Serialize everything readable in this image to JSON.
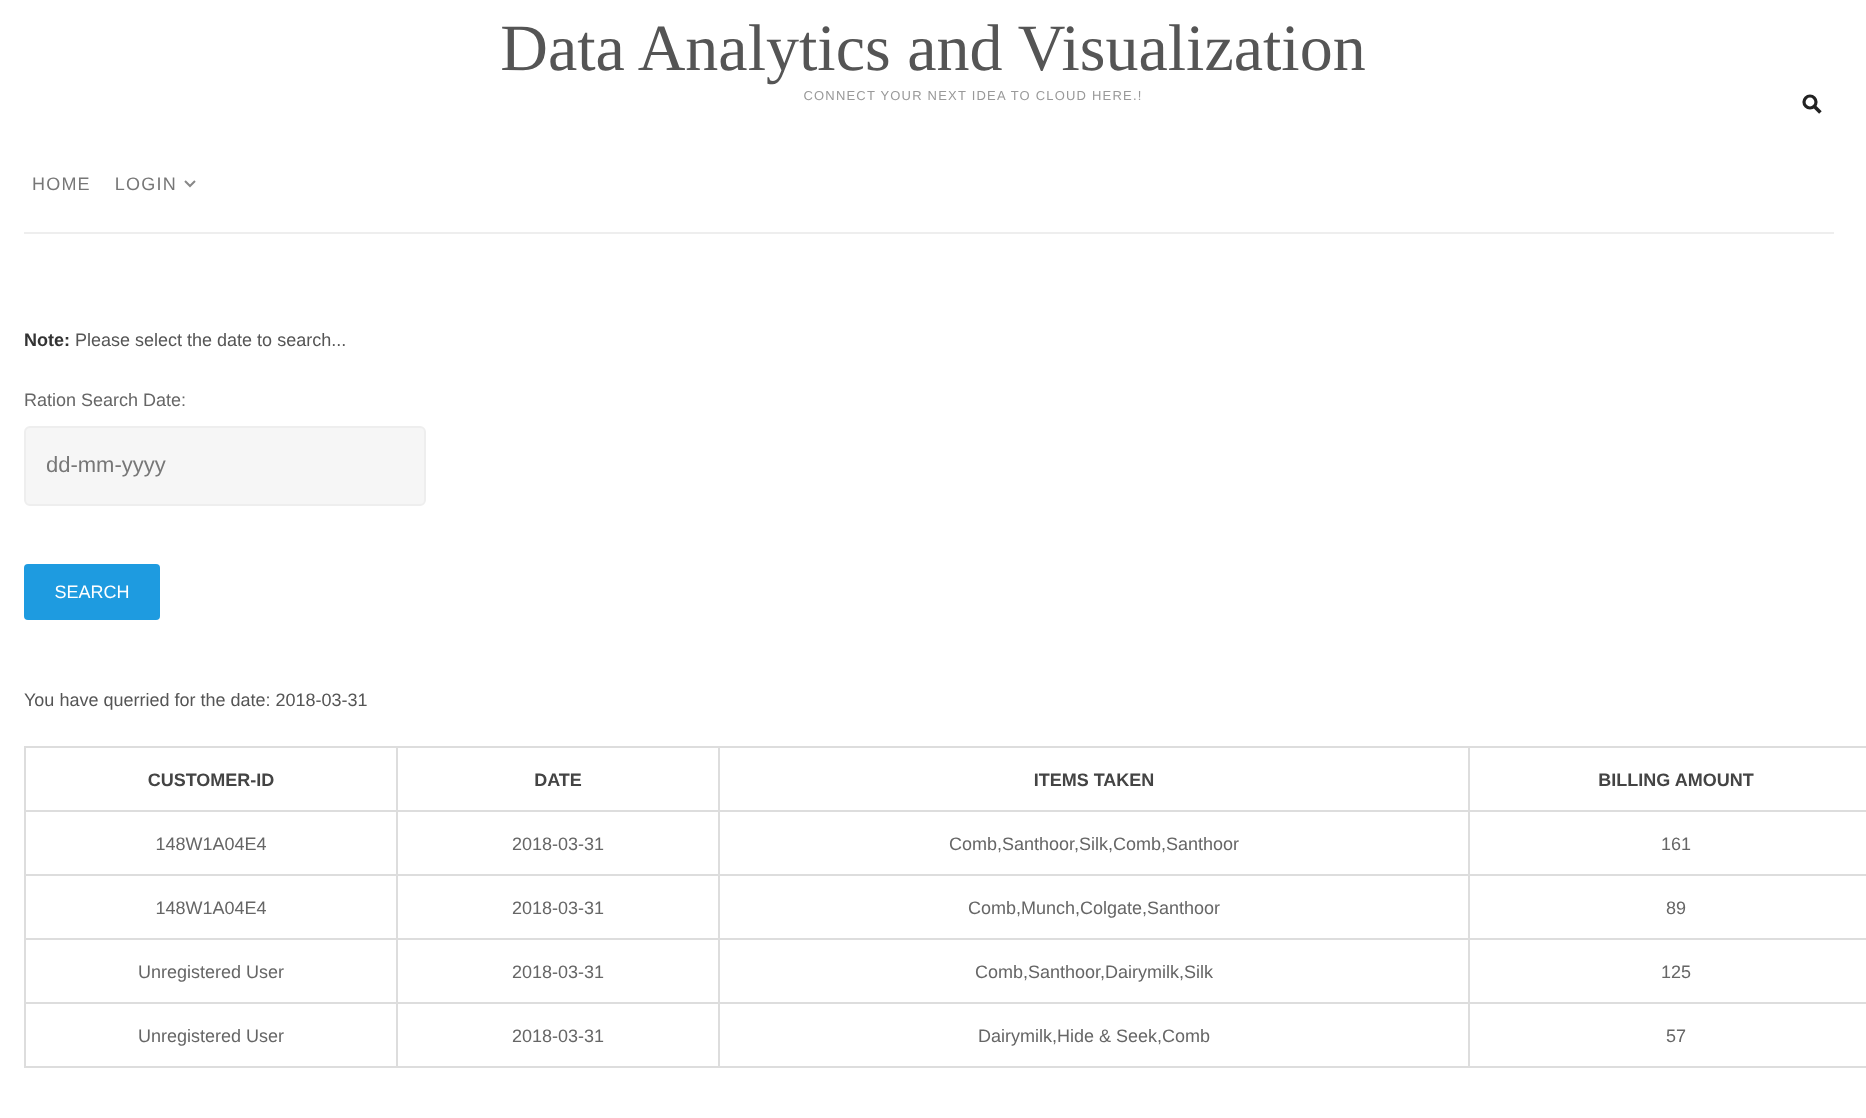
{
  "header": {
    "title": "Data Analytics and Visualization",
    "tagline": "CONNECT YOUR NEXT IDEA TO CLOUD HERE.!"
  },
  "nav": [
    {
      "label": "HOME",
      "dropdown": false
    },
    {
      "label": "LOGIN",
      "dropdown": true
    }
  ],
  "note": "**Note:** Please select the date to search...",
  "form": {
    "label": "Ration Search Date:",
    "placeholder": "dd-mm-yyyy",
    "button": "SEARCH"
  },
  "query_text": "You have querried for the date: 2018-03-31",
  "table": {
    "columns": [
      "CUSTOMER-ID",
      "DATE",
      "ITEMS TAKEN",
      "BILLING AMOUNT"
    ],
    "rows": [
      [
        "148W1A04E4",
        "2018-03-31",
        "Comb,Santhoor,Silk,Comb,Santhoor",
        "161"
      ],
      [
        "148W1A04E4",
        "2018-03-31",
        "Comb,Munch,Colgate,Santhoor",
        "89"
      ],
      [
        "Unregistered User",
        "2018-03-31",
        "Comb,Santhoor,Dairymilk,Silk",
        "125"
      ],
      [
        "Unregistered User",
        "2018-03-31",
        "Dairymilk,Hide & Seek,Comb",
        "57"
      ]
    ]
  }
}
